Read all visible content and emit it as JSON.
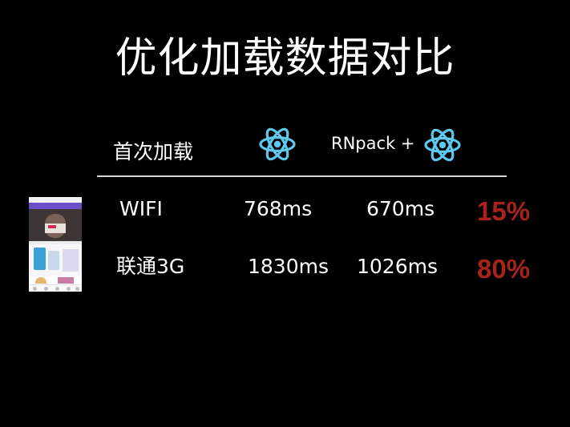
{
  "slide": {
    "title": "优化加载数据对比",
    "header": {
      "first_load": "首次加载",
      "rnpack_prefix": "RNpack +"
    },
    "rows": [
      {
        "network": "WIFI",
        "baseline": "768ms",
        "rnpack": "670ms",
        "improvement": "15%"
      },
      {
        "network": "联通3G",
        "baseline": "1830ms",
        "rnpack": "1026ms",
        "improvement": "80%"
      }
    ],
    "icons": {
      "react_logo": "react-logo-icon",
      "app_preview": "app-screenshot-thumbnail"
    },
    "colors": {
      "background": "#000000",
      "text": "#ffffff",
      "react_blue": "#5fc8ec",
      "highlight_red": "#a8231b",
      "divider": "#d6d6d6"
    }
  }
}
